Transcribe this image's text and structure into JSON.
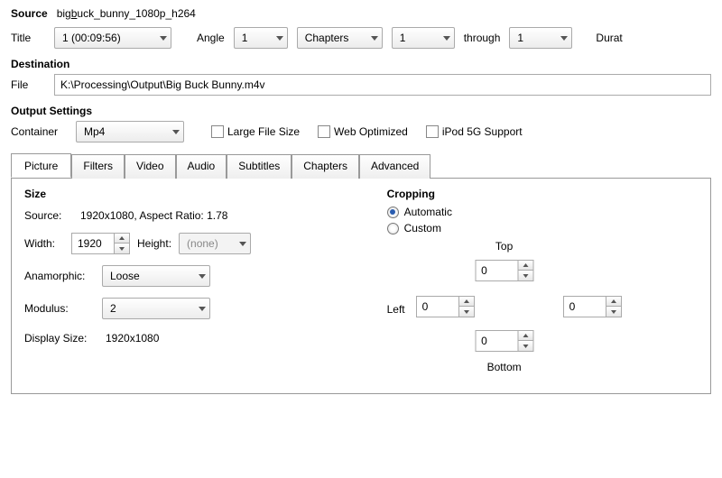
{
  "source": {
    "label": "Source",
    "value_prefix": "big",
    "value_u": "b",
    "value_suffix": "uck_bunny_1080p_h264",
    "title_label": "Title",
    "title_value": "1 (00:09:56)",
    "angle_label": "Angle",
    "angle_value": "1",
    "range_type": "Chapters",
    "range_start": "1",
    "through_label": "through",
    "range_end": "1",
    "duration_label": "Durat"
  },
  "destination": {
    "heading": "Destination",
    "file_label": "File",
    "file_value": "K:\\Processing\\Output\\Big Buck Bunny.m4v"
  },
  "output": {
    "heading": "Output Settings",
    "container_label": "Container",
    "container_value": "Mp4",
    "large_file": "Large File Size",
    "web_opt": "Web Optimized",
    "ipod": "iPod 5G Support"
  },
  "tabs": [
    "Picture",
    "Filters",
    "Video",
    "Audio",
    "Subtitles",
    "Chapters",
    "Advanced"
  ],
  "picture": {
    "size_heading": "Size",
    "source_label": "Source:",
    "source_value": "1920x1080, Aspect Ratio: 1.78",
    "width_label": "Width:",
    "width_value": "1920",
    "height_label": "Height:",
    "height_value": "(none)",
    "anamorphic_label": "Anamorphic:",
    "anamorphic_value": "Loose",
    "modulus_label": "Modulus:",
    "modulus_value": "2",
    "display_size_label": "Display Size:",
    "display_size_value": "1920x1080",
    "cropping_heading": "Cropping",
    "auto": "Automatic",
    "custom": "Custom",
    "top": "Top",
    "left": "Left",
    "bottom": "Bottom",
    "crop_top": "0",
    "crop_left": "0",
    "crop_right": "0",
    "crop_bottom": "0"
  }
}
